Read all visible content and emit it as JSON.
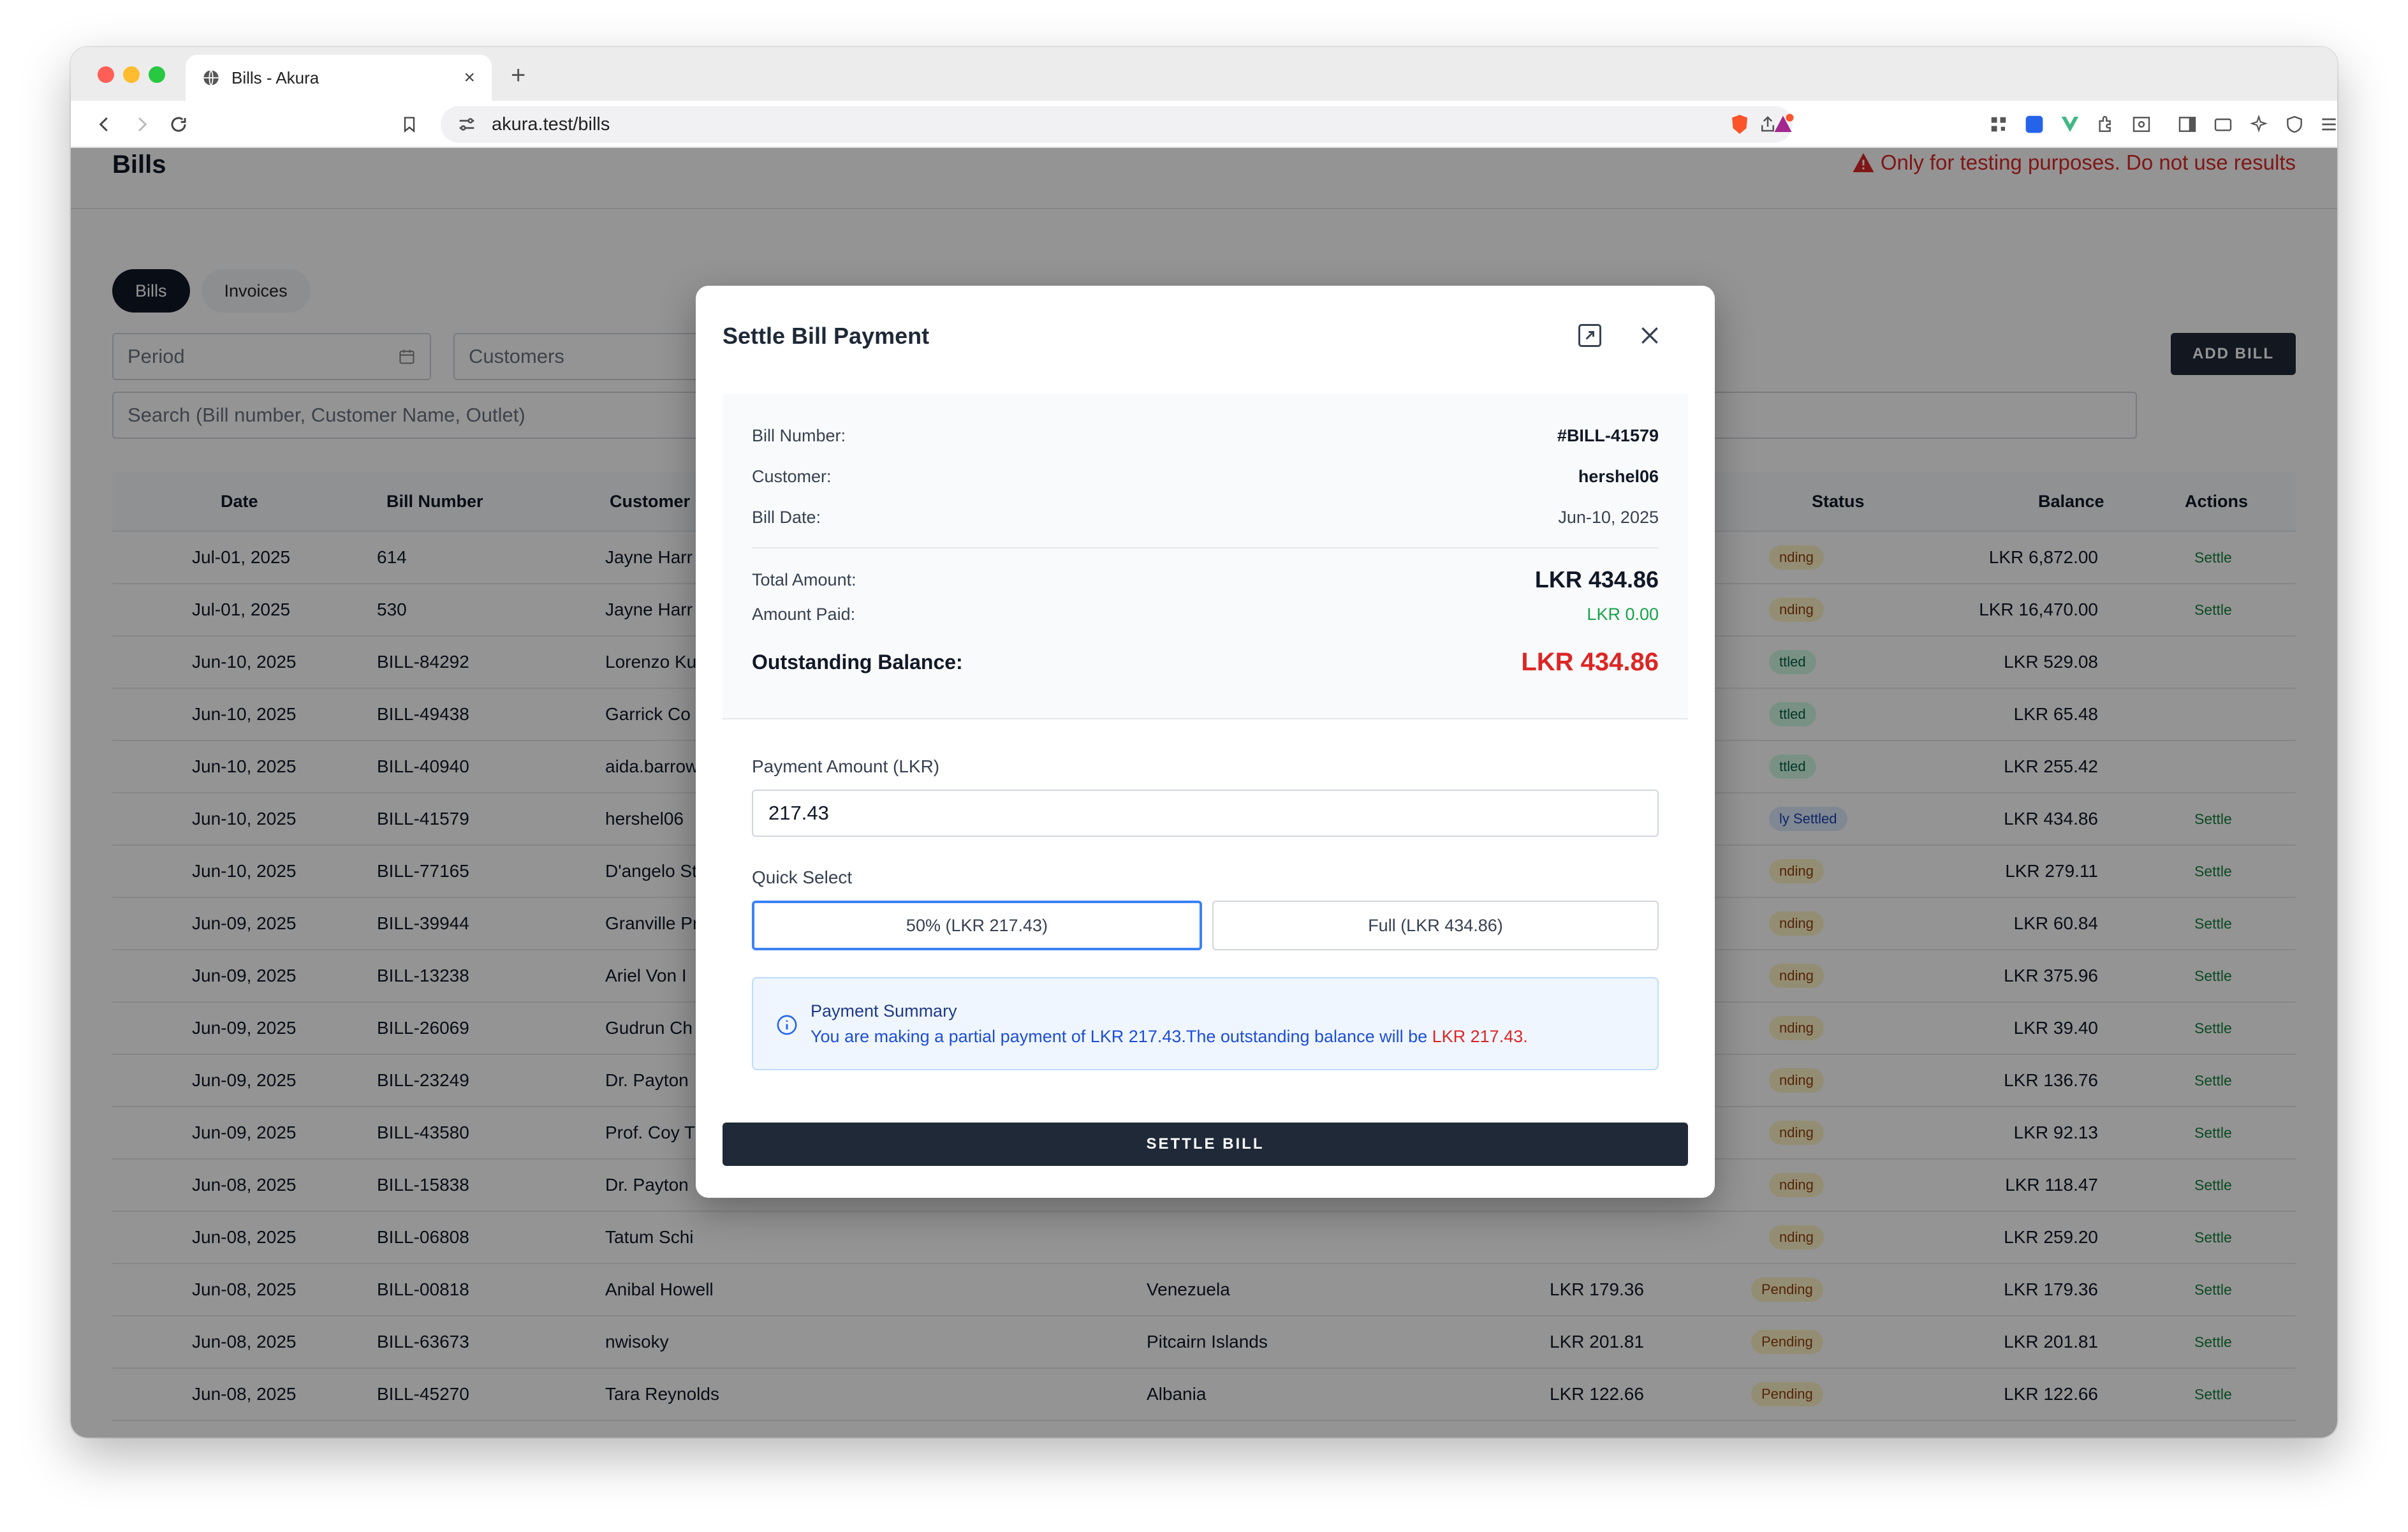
{
  "browser": {
    "tab_title": "Bills - Akura",
    "url": "akura.test/bills"
  },
  "page": {
    "title": "Bills",
    "warning": "Only for testing purposes. Do not use results",
    "tabs": [
      "Bills",
      "Invoices"
    ],
    "filters": {
      "period_placeholder": "Period",
      "customers_placeholder": "Customers"
    },
    "search_placeholder": "Search (Bill number, Customer Name, Outlet)",
    "add_bill_label": "ADD BILL"
  },
  "table": {
    "headers": {
      "date": "Date",
      "bill_number": "Bill Number",
      "customer": "Customer",
      "status": "Status",
      "balance": "Balance",
      "actions": "Actions"
    },
    "rows": [
      {
        "date": "Jul-01, 2025",
        "bill": "614",
        "customer": "Jayne Harr",
        "status": "nding",
        "balance": "LKR 6,872.00",
        "action": "Settle"
      },
      {
        "date": "Jul-01, 2025",
        "bill": "530",
        "customer": "Jayne Harr",
        "status": "nding",
        "balance": "LKR 16,470.00",
        "action": "Settle"
      },
      {
        "date": "Jun-10, 2025",
        "bill": "BILL-84292",
        "customer": "Lorenzo Ku",
        "status": "ttled",
        "balance": "LKR 529.08",
        "action": ""
      },
      {
        "date": "Jun-10, 2025",
        "bill": "BILL-49438",
        "customer": "Garrick Co",
        "status": "ttled",
        "balance": "LKR 65.48",
        "action": ""
      },
      {
        "date": "Jun-10, 2025",
        "bill": "BILL-40940",
        "customer": "aida.barrow",
        "status": "ttled",
        "balance": "LKR 255.42",
        "action": ""
      },
      {
        "date": "Jun-10, 2025",
        "bill": "BILL-41579",
        "customer": "hershel06",
        "status": "ly Settled",
        "balance": "LKR 434.86",
        "action": "Settle"
      },
      {
        "date": "Jun-10, 2025",
        "bill": "BILL-77165",
        "customer": "D'angelo St",
        "status": "nding",
        "balance": "LKR 279.11",
        "action": "Settle"
      },
      {
        "date": "Jun-09, 2025",
        "bill": "BILL-39944",
        "customer": "Granville Pr",
        "status": "nding",
        "balance": "LKR 60.84",
        "action": "Settle"
      },
      {
        "date": "Jun-09, 2025",
        "bill": "BILL-13238",
        "customer": "Ariel Von I",
        "status": "nding",
        "balance": "LKR 375.96",
        "action": "Settle"
      },
      {
        "date": "Jun-09, 2025",
        "bill": "BILL-26069",
        "customer": "Gudrun Ch",
        "status": "nding",
        "balance": "LKR 39.40",
        "action": "Settle"
      },
      {
        "date": "Jun-09, 2025",
        "bill": "BILL-23249",
        "customer": "Dr. Payton",
        "status": "nding",
        "balance": "LKR 136.76",
        "action": "Settle"
      },
      {
        "date": "Jun-09, 2025",
        "bill": "BILL-43580",
        "customer": "Prof. Coy T",
        "status": "nding",
        "balance": "LKR 92.13",
        "action": "Settle"
      },
      {
        "date": "Jun-08, 2025",
        "bill": "BILL-15838",
        "customer": "Dr. Payton",
        "status": "nding",
        "balance": "LKR 118.47",
        "action": "Settle"
      },
      {
        "date": "Jun-08, 2025",
        "bill": "BILL-06808",
        "customer": "Tatum Schi",
        "status": "nding",
        "balance": "LKR 259.20",
        "action": "Settle"
      },
      {
        "date": "Jun-08, 2025",
        "bill": "BILL-00818",
        "customer": "Anibal Howell",
        "outlet": "Venezuela",
        "total": "LKR 179.36",
        "status": "Pending",
        "balance": "LKR 179.36",
        "action": "Settle"
      },
      {
        "date": "Jun-08, 2025",
        "bill": "BILL-63673",
        "customer": "nwisoky",
        "outlet": "Pitcairn Islands",
        "total": "LKR 201.81",
        "status": "Pending",
        "balance": "LKR 201.81",
        "action": "Settle"
      },
      {
        "date": "Jun-08, 2025",
        "bill": "BILL-45270",
        "customer": "Tara Reynolds",
        "outlet": "Albania",
        "total": "LKR 122.66",
        "status": "Pending",
        "balance": "LKR 122.66",
        "action": "Settle"
      }
    ]
  },
  "modal": {
    "title": "Settle Bill Payment",
    "bill_number_label": "Bill Number:",
    "bill_number": "#BILL-41579",
    "customer_label": "Customer:",
    "customer": "hershel06",
    "bill_date_label": "Bill Date:",
    "bill_date": "Jun-10, 2025",
    "total_label": "Total Amount:",
    "total": "LKR 434.86",
    "paid_label": "Amount Paid:",
    "paid": "LKR 0.00",
    "outstanding_label": "Outstanding Balance:",
    "outstanding": "LKR 434.86",
    "payment_label": "Payment Amount (LKR)",
    "payment_value": "217.43",
    "quick_label": "Quick Select",
    "quick_half": "50% (LKR 217.43)",
    "quick_full": "Full (LKR 434.86)",
    "summary_title": "Payment Summary",
    "summary_text": "You are making a partial payment of LKR 217.43.The outstanding balance will be ",
    "summary_remaining": "LKR 217.43",
    "summary_end": ".",
    "settle_label": "SETTLE BILL"
  },
  "colors": {
    "accent": "#1f2937",
    "danger": "#dc2626",
    "success": "#16a34a",
    "info": "#2563eb"
  }
}
